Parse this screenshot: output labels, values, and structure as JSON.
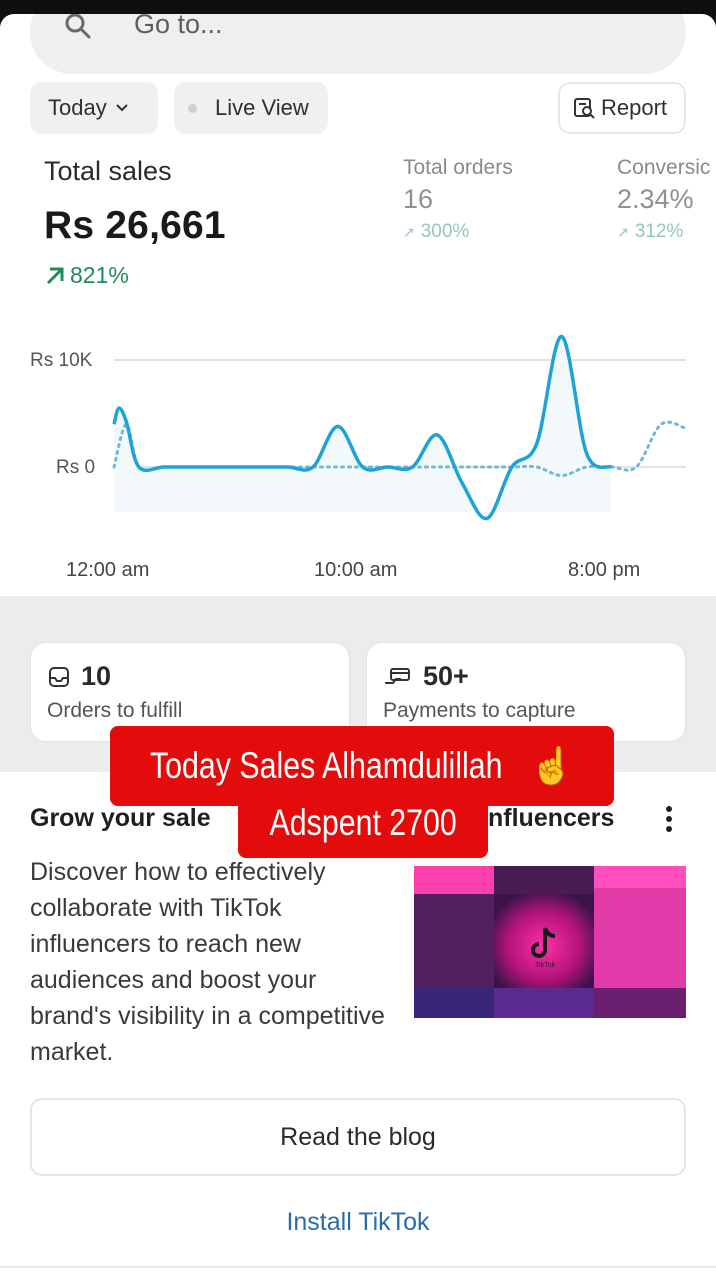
{
  "search": {
    "placeholder": "Go to..."
  },
  "filters": {
    "today_label": "Today",
    "live_label": "Live View",
    "report_label": "Report"
  },
  "metrics": {
    "total_sales": {
      "label": "Total sales",
      "value": "Rs 26,661",
      "delta": "821%"
    },
    "total_orders": {
      "label": "Total orders",
      "value": "16",
      "delta": "300%"
    },
    "conversion": {
      "label": "Conversic",
      "value": "2.34%",
      "delta": "312%"
    }
  },
  "chart_data": {
    "type": "line",
    "title": "",
    "xlabel": "",
    "ylabel": "",
    "y_ticks": [
      "Rs 10K",
      "Rs 0"
    ],
    "x_ticks": [
      "12:00 am",
      "10:00 am",
      "8:00 pm"
    ],
    "ylim": [
      -5000,
      14000
    ],
    "series": [
      {
        "style": "solid",
        "color": "#1fa3d6",
        "x": [
          0,
          0.2,
          0.5,
          1,
          2,
          3,
          4,
          5,
          6,
          7,
          8,
          9,
          10,
          11,
          12,
          13,
          14,
          15,
          16,
          17,
          18,
          19,
          20
        ],
        "values": [
          4000,
          5500,
          4200,
          0,
          0,
          0,
          0,
          0,
          0,
          0,
          0,
          3800,
          0,
          0,
          0,
          3000,
          -1500,
          -4800,
          0,
          2200,
          12200,
          1300,
          0
        ]
      },
      {
        "style": "dotted",
        "color": "#6fb8d8",
        "x": [
          0,
          0.5,
          1,
          2,
          3,
          4,
          5,
          6,
          7,
          8,
          9,
          10,
          11,
          12,
          13,
          14,
          15,
          16,
          17,
          18,
          19,
          20,
          21,
          22,
          23
        ],
        "values": [
          0,
          4000,
          0,
          0,
          0,
          0,
          0,
          0,
          0,
          0,
          0,
          0,
          0,
          0,
          0,
          0,
          0,
          0,
          0,
          -800,
          0,
          0,
          0,
          4000,
          3600
        ]
      }
    ]
  },
  "cards": [
    {
      "value": "10",
      "caption": "Orders to fulfill",
      "icon": "inbox-icon"
    },
    {
      "value": "50+",
      "caption": "Payments to capture",
      "icon": "payment-icon"
    }
  ],
  "blog": {
    "title_left": "Grow your sale",
    "title_right": "nfluencers",
    "description": "Discover how to effectively collaborate with TikTok influencers to reach new audiences and boost your brand's visibility in a competitive market.",
    "button_label": "Read the blog",
    "install_label": "Install TikTok",
    "thumbnail_text": "TikTok"
  },
  "overlay": {
    "line1": "Today Sales Alhamdulillah",
    "emoji": "☝️",
    "line2": "Adspent 2700",
    "color": "#e30b0b"
  }
}
